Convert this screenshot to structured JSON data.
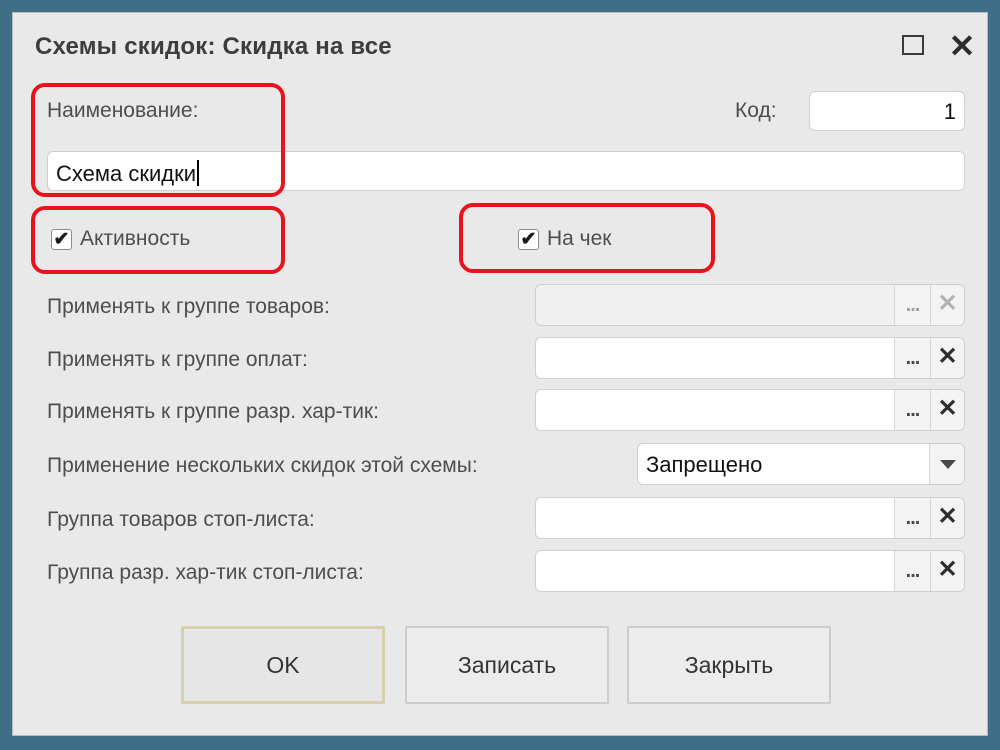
{
  "window": {
    "title": "Схемы скидок: Скидка на все"
  },
  "form": {
    "name_label": "Наименование:",
    "name_value": "Схема скидки",
    "code_label": "Код:",
    "code_value": "1",
    "active_label": "Активность",
    "active_checked": true,
    "receipt_label": "На чек",
    "receipt_checked": true,
    "rows": [
      {
        "label": "Применять к группе товаров:",
        "value": "",
        "enabled": false
      },
      {
        "label": "Применять к группе оплат:",
        "value": "",
        "enabled": true
      },
      {
        "label": "Применять к группе разр. хар-тик:",
        "value": "",
        "enabled": true
      },
      {
        "label": "Применение нескольких скидок этой схемы:",
        "value": "Запрещено"
      },
      {
        "label": "Группа товаров стоп-листа:",
        "value": "",
        "enabled": true
      },
      {
        "label": "Группа разр. хар-тик стоп-листа:",
        "value": "",
        "enabled": true
      }
    ],
    "select_button_glyph": "...",
    "clear_button_glyph": "✕"
  },
  "buttons": {
    "ok": "OK",
    "save": "Записать",
    "close": "Закрыть"
  },
  "icons": {
    "maximize": "maximize-icon",
    "close": "close-icon",
    "check": "✔",
    "dropdown": "chevron-down-icon"
  },
  "colors": {
    "highlight": "#e8141d",
    "background": "#3f6f86"
  }
}
